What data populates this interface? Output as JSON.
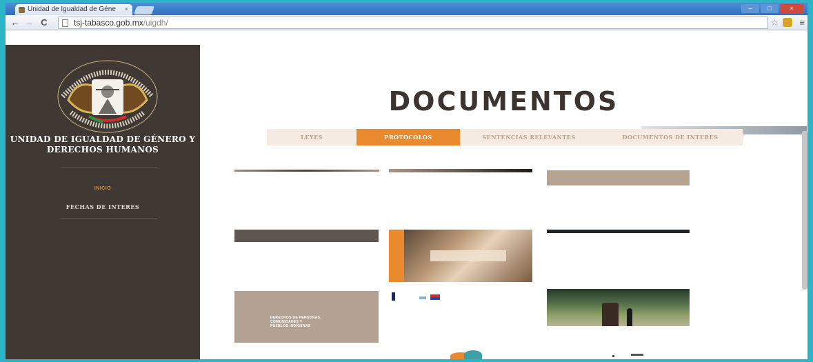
{
  "browser": {
    "tab_title": "Unidad de Igualdad de Géne",
    "tab_close": "×",
    "url_host": "tsj-tabasco.gob.mx",
    "url_path": "/uigdh/",
    "back_icon": "back-arrow-icon",
    "forward_icon": "forward-arrow-icon",
    "reload_icon": "reload-icon"
  },
  "sidebar": {
    "unit_title_line1": "UNIDAD DE IGUALDAD DE GÉNERO Y",
    "unit_title_line2": "DERECHOS HUMANOS",
    "nav_inicio": "INICIO",
    "nav_fechas": "FECHAS DE INTERES"
  },
  "main": {
    "title": "DOCUMENTOS",
    "tabs": [
      {
        "label": "LEYES",
        "active": false
      },
      {
        "label": "PROTOCOLOS",
        "active": true
      },
      {
        "label": "SENTENCIAS RELEVANTES",
        "active": false
      },
      {
        "label": "DOCUMENTOS DE INTERES",
        "active": false
      }
    ],
    "card_text_8_line1": "DERECHOS DE PERSONAS,",
    "card_text_8_line2": "COMUNIDADES Y",
    "card_text_8_line3": "PUEBLOS INDIGENAS"
  },
  "colors": {
    "sidebar_bg": "#3f3833",
    "accent_orange": "#e98a2f",
    "tab_bg": "#f5ebe3",
    "title_dark": "#3b3431"
  }
}
